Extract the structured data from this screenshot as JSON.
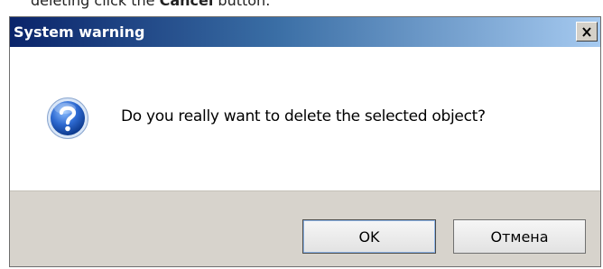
{
  "doc_fragment": {
    "before": "deleting click the",
    "bold": "Cancel",
    "after": "button."
  },
  "dialog": {
    "title": "System warning",
    "message": "Do you really want to delete the selected object?",
    "icon": "question-icon",
    "buttons": {
      "ok_label": "OK",
      "cancel_label": "Отмена"
    }
  },
  "colors": {
    "titlebar_start": "#0a246a",
    "titlebar_end": "#a6caf0",
    "footer_bg": "#d7d3cc",
    "icon_blue": "#1f56b3"
  }
}
